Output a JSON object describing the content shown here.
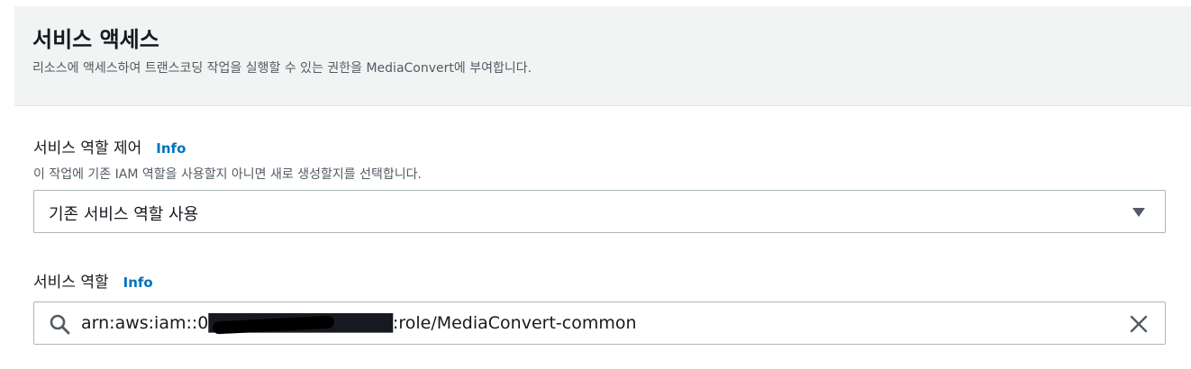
{
  "header": {
    "title": "서비스 액세스",
    "description": "리소스에 액세스하여 트랜스코딩 작업을 실행할 수 있는 권한을 MediaConvert에 부여합니다."
  },
  "role_control": {
    "label": "서비스 역할 제어",
    "info": "Info",
    "hint": "이 작업에 기존 IAM 역할을 사용할지 아니면 새로 생성할지를 선택합니다.",
    "selected_value": "기존 서비스 역할 사용",
    "caret_icon": "caret-down-icon"
  },
  "service_role": {
    "label": "서비스 역할",
    "info": "Info",
    "value": "arn:aws:iam::0██████████████:role/MediaConvert-common",
    "search_icon": "search-icon",
    "clear_icon": "close-icon"
  }
}
